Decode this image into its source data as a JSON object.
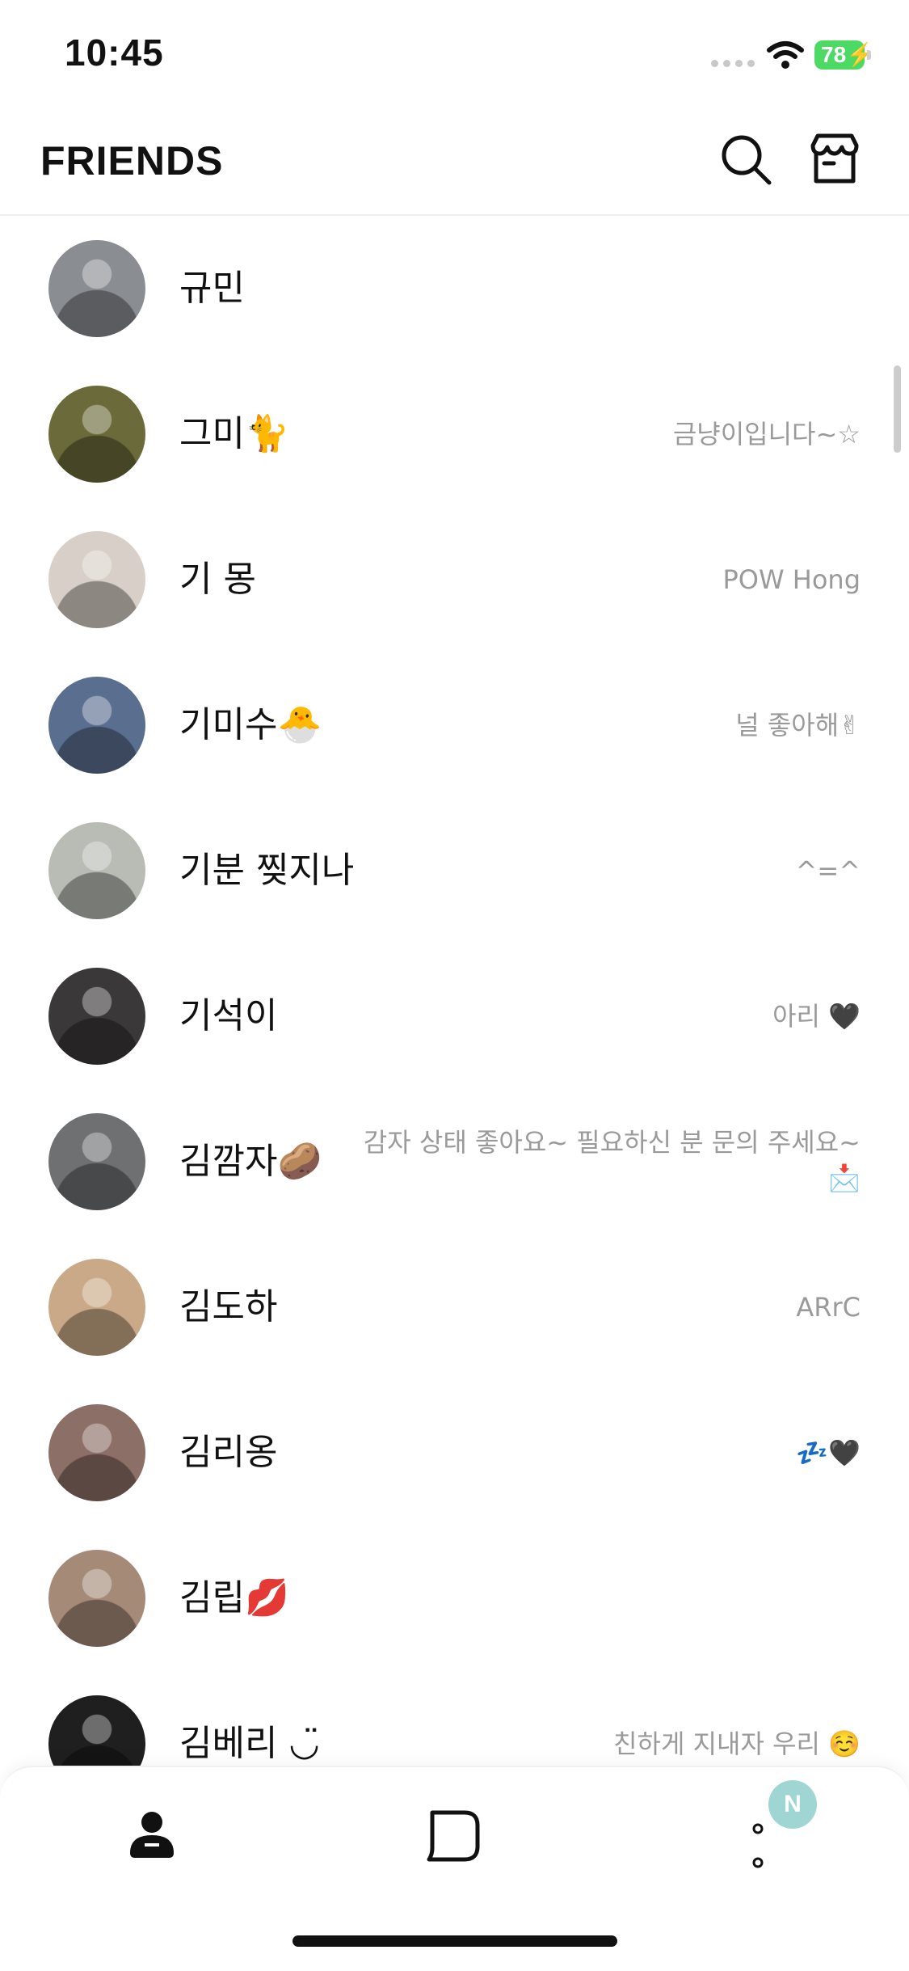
{
  "status_bar": {
    "time": "10:45",
    "battery": "78"
  },
  "header": {
    "title": "FRIENDS"
  },
  "icons": {
    "search": "search-icon",
    "shop": "shop-icon",
    "friends_tab": "person-icon",
    "chat_tab": "chat-bubble-icon",
    "more_tab": "more-dots-icon"
  },
  "friends": [
    {
      "name": "규민",
      "status": "",
      "avatar_color": "#8a8d92"
    },
    {
      "name": "그미🐈",
      "status": "금냥이입니다~☆",
      "avatar_color": "#6b6a3a"
    },
    {
      "name": "기 몽",
      "status": "POW Hong",
      "avatar_color": "#d8cfc8"
    },
    {
      "name": "기미수🐣",
      "status": "널 좋아해✌",
      "avatar_color": "#5a6f8f"
    },
    {
      "name": "기분 찢지나",
      "status": "^=^",
      "avatar_color": "#b9bcb5"
    },
    {
      "name": "기석이",
      "status": "아리 🖤",
      "avatar_color": "#3a3838"
    },
    {
      "name": "김깜자🥔",
      "status": "감자 상태 좋아요~ 필요하신 분 문의 주세요~",
      "status2": "📩",
      "avatar_color": "#6f7072"
    },
    {
      "name": "김도하",
      "status": "ARrC",
      "avatar_color": "#c9a987"
    },
    {
      "name": "김리옹",
      "status": "💤🖤",
      "avatar_color": "#8c6f66"
    },
    {
      "name": "김립💋",
      "status": "",
      "avatar_color": "#a58a78"
    },
    {
      "name": "김베리 ◡̈",
      "status": "친하게 지내자 우리 ☺️",
      "avatar_color": "#1f1f1f"
    }
  ],
  "tabbar": {
    "badge": "N"
  }
}
